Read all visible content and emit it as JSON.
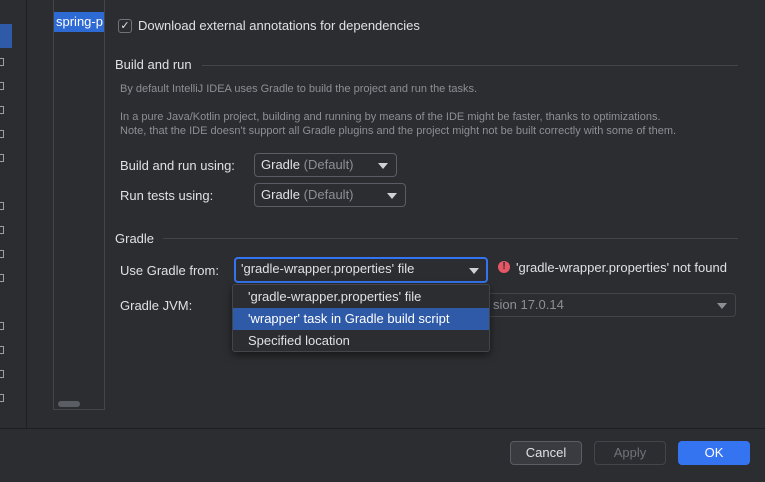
{
  "project_list": {
    "item": "spring-p"
  },
  "download_annotations": {
    "checked": true,
    "check_glyph": "✓",
    "label": "Download external annotations for dependencies"
  },
  "build_and_run": {
    "title": "Build and run",
    "hint1": "By default IntelliJ IDEA uses Gradle to build the project and run the tasks.",
    "hint2": "In a pure Java/Kotlin project, building and running by means of the IDE might be faster, thanks to optimizations.",
    "hint3": "Note, that the IDE doesn't support all Gradle plugins and the project might not be built correctly with some of them.",
    "build_label": "Build and run using:",
    "build_value": "Gradle",
    "build_suffix": "(Default)",
    "tests_label": "Run tests using:",
    "tests_value": "Gradle",
    "tests_suffix": "(Default)"
  },
  "gradle": {
    "title": "Gradle",
    "use_from_label": "Use Gradle from:",
    "use_from_value": "'gradle-wrapper.properties' file",
    "error_glyph": "!",
    "error_text": "'gradle-wrapper.properties' not found",
    "jvm_label": "Gradle JVM:",
    "jvm_value_partial": "sion 17.0.14",
    "options": [
      "'gradle-wrapper.properties' file",
      "'wrapper' task in Gradle build script",
      "Specified location"
    ]
  },
  "buttons": {
    "cancel": "Cancel",
    "apply": "Apply",
    "ok": "OK"
  },
  "colors": {
    "accent": "#3574f0",
    "selection": "#2e5aa8",
    "error": "#e55765",
    "background": "#2b2d30"
  }
}
